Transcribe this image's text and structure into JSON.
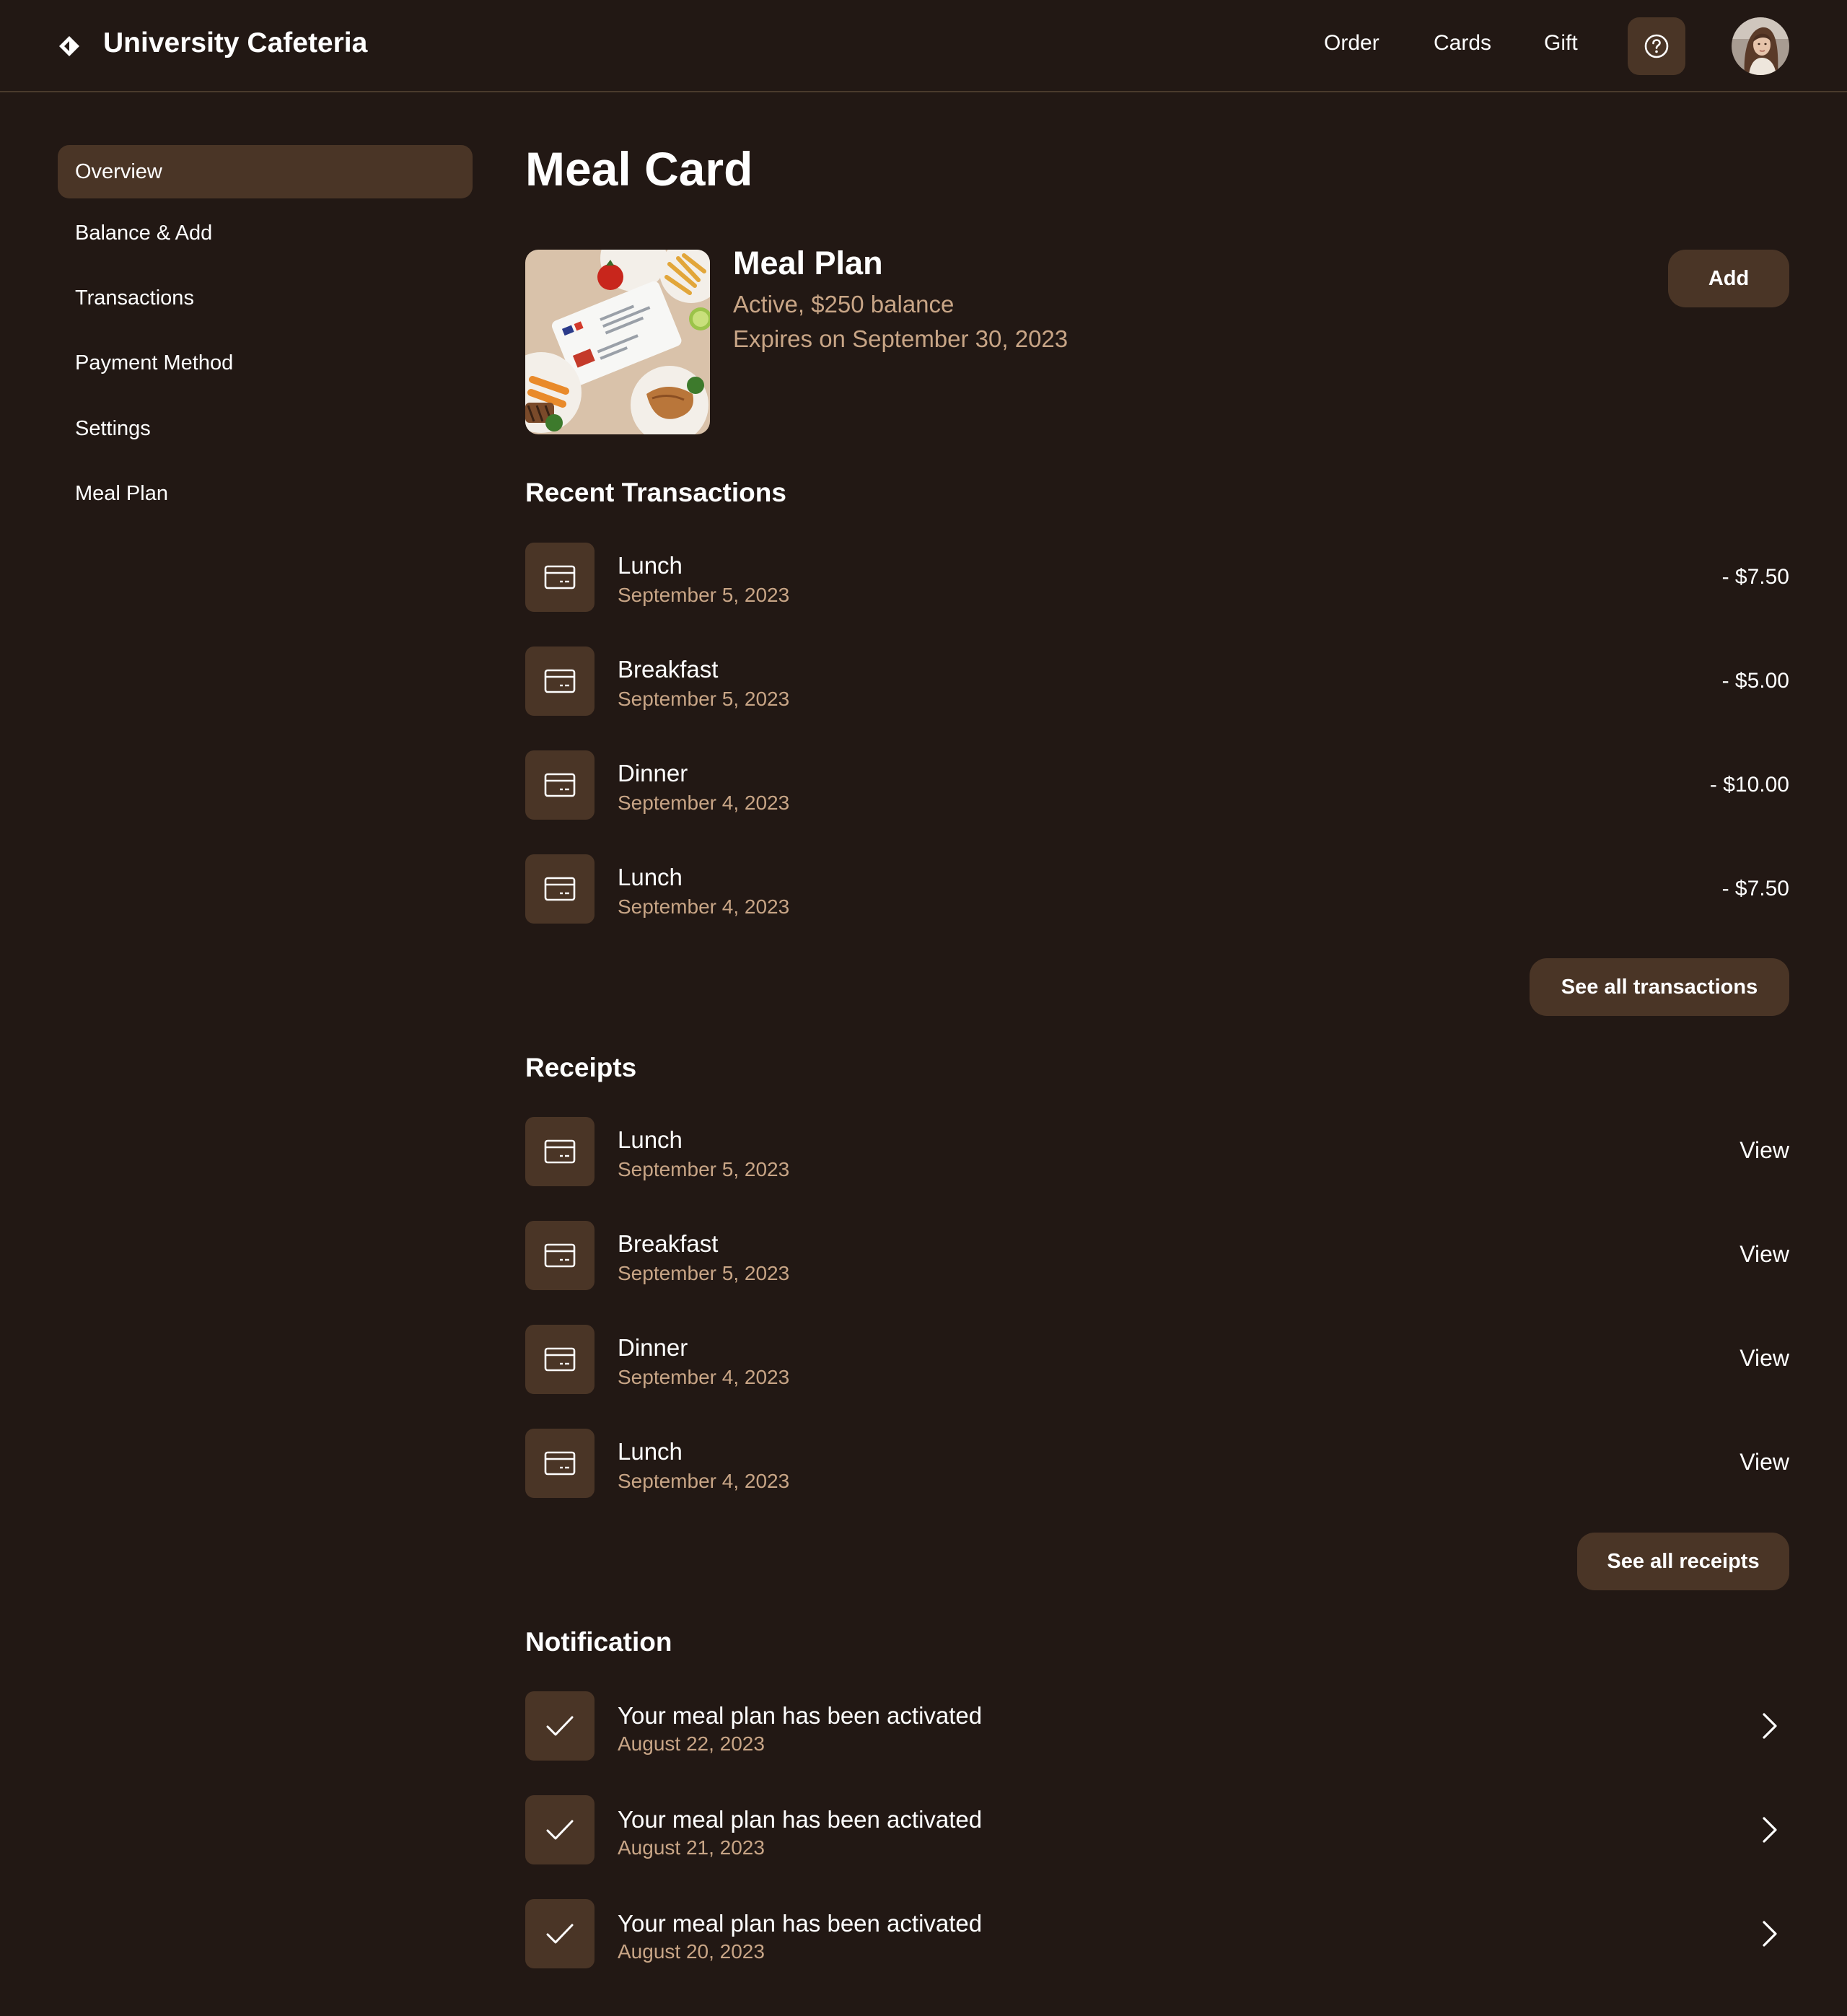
{
  "header": {
    "app_title": "University Cafeteria",
    "logo_icon": "diamond-icon",
    "nav": [
      "Order",
      "Cards",
      "Gift"
    ],
    "help_icon": "question-circle-icon"
  },
  "sidebar": {
    "items": [
      {
        "label": "Overview",
        "active": true
      },
      {
        "label": "Balance & Add",
        "active": false
      },
      {
        "label": "Transactions",
        "active": false
      },
      {
        "label": "Payment Method",
        "active": false
      },
      {
        "label": "Settings",
        "active": false
      },
      {
        "label": "Meal Plan",
        "active": false
      }
    ]
  },
  "main": {
    "title": "Meal Card",
    "plan": {
      "name": "Meal Plan",
      "status": "Active, $250 balance",
      "expires": "Expires on September 30, 2023",
      "add_label": "Add"
    },
    "transactions": {
      "title": "Recent Transactions",
      "items": [
        {
          "title": "Lunch",
          "date": "September 5, 2023",
          "amount": "- $7.50"
        },
        {
          "title": "Breakfast",
          "date": "September 5, 2023",
          "amount": "- $5.00"
        },
        {
          "title": "Dinner",
          "date": "September 4, 2023",
          "amount": "- $10.00"
        },
        {
          "title": "Lunch",
          "date": "September 4, 2023",
          "amount": "- $7.50"
        }
      ],
      "see_all_label": "See all transactions"
    },
    "receipts": {
      "title": "Receipts",
      "items": [
        {
          "title": "Lunch",
          "date": "September 5, 2023",
          "action": "View"
        },
        {
          "title": "Breakfast",
          "date": "September 5, 2023",
          "action": "View"
        },
        {
          "title": "Dinner",
          "date": "September 4, 2023",
          "action": "View"
        },
        {
          "title": "Lunch",
          "date": "September 4, 2023",
          "action": "View"
        }
      ],
      "see_all_label": "See all receipts"
    },
    "notifications": {
      "title": "Notification",
      "items": [
        {
          "title": "Your meal plan has been activated",
          "date": "August 22, 2023"
        },
        {
          "title": "Your meal plan has been activated",
          "date": "August 21, 2023"
        },
        {
          "title": "Your meal plan has been activated",
          "date": "August 20, 2023"
        }
      ]
    }
  },
  "colors": {
    "background": "#221814",
    "accent_surface": "#4a3526",
    "muted_text": "#c8a586",
    "divider": "#4a3a2c"
  },
  "icons": {
    "row_icon": "credit-card-icon",
    "notification_icon": "check-icon",
    "chevron": "chevron-right-icon"
  }
}
